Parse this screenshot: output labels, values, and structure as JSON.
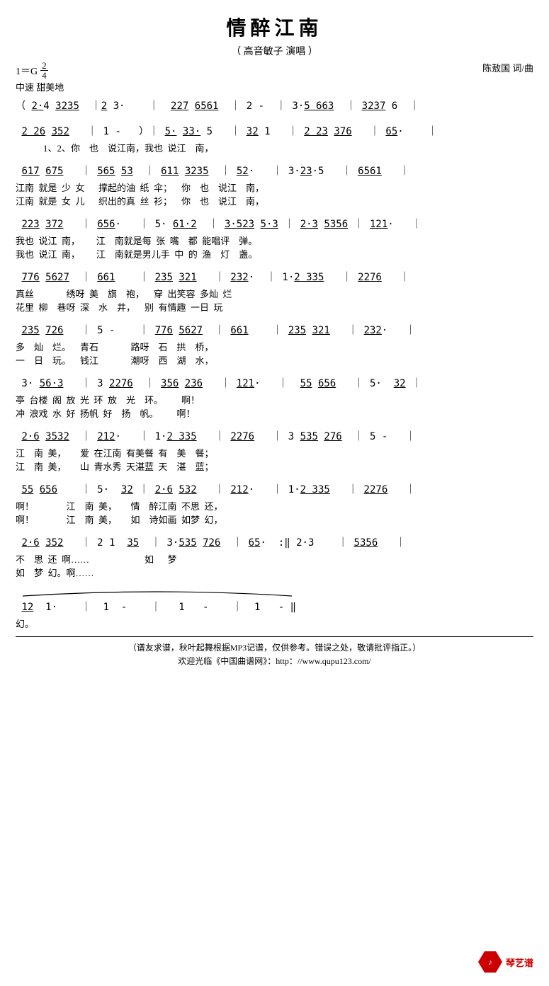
{
  "title": "情醉江南",
  "subtitle": "（ 高音敏子 演唱 ）",
  "composer": "陈敖国 词/曲",
  "key": "1＝G",
  "time_sig": {
    "num": "2",
    "den": "4"
  },
  "tempo": "中速 甜美地",
  "footer": {
    "line1": "（谱友求谱，秋叶起舞根据MP3记谱，仅供参考。错误之处，敬请批评指正。）",
    "line2": "欢迎光临《中国曲谱网》：http：//www.qupu123.com/"
  },
  "watermark": "琴艺谱",
  "staff_lines": [
    {
      "notation": "（ 2·4 3235  | 2 3·    |  227 6561  | 2 -   | 3·5 663   | 3237 6  |",
      "lyrics1": "",
      "lyrics2": ""
    },
    {
      "notation": " 2 26 352   | 1 -   )| 5· 33· 5   | 3̲2̲ 1   | 2 23 376   | 65·    |",
      "lyrics1": "           1、2、你    也    说江南，我也  说江    南，",
      "lyrics2": ""
    },
    {
      "notation": " 617 675   | 565 53  | 611 3235  | 52·   | 3·23·5   | 6561   |",
      "lyrics1": "江南  就是  少  女      撑起的油  纸  伞；    你    也    说江    南，",
      "lyrics2": "江南  就是  女  儿      织出的真  丝  衫；    你    也    说江    南，"
    },
    {
      "notation": " 223 372   | 656·   | 5· 61·2  | 3·523 5·3 | 2·3 5356 | 121·   |",
      "lyrics1": "我也  说江  南，       江    南就是每  张  嘴    都  能唱评    弹。",
      "lyrics2": "我也  说江  南，       江    南就是男儿手  中  的  渔    灯    盏。"
    },
    {
      "notation": " 776 5627  | 661    | 235 321   | 232·  | 1·2 335   | 2276   |",
      "lyrics1": "真丝              绣呀  美    旗    袍，    穿  出笑容  多灿  烂",
      "lyrics2": "花里  柳    巷呀  深    水    井，    别  有情趣  一日  玩"
    },
    {
      "notation": " 235 726   | 5 -    | 776 5627  | 661    | 235 321   | 232·   |",
      "lyrics1": "多    灿    烂。    青石              路呀    石    拱    桥，",
      "lyrics2": "一    日    玩。    钱江              潮呀    西    湖    水，"
    },
    {
      "notation": " 3· 56·3   | 3 2276  | 356 236   | 121·   |  55 656   | 5·  32 |",
      "lyrics1": "亭  台楼  阁  放  光  环  放    光    环。        啊！",
      "lyrics2": "冲  浪戏  水  好  扬帆  好    扬    帆。        啊！"
    },
    {
      "notation": " 2·6 3532  | 212·   | 1·2 335   | 2276   | 3 535 276  | 5 -   |",
      "lyrics1": "江    南  美，      爱  在江南  有美餐  有    美    餐；",
      "lyrics2": "江    南  美，      山  青水秀  天湛蓝  天    湛    蓝；"
    },
    {
      "notation": " 55 656    | 5·  32 | 2·6 532   | 212·   | 1·2 335   | 2276   |",
      "lyrics1": "啊！              江    南  美，      情    醉江南  不思  还，",
      "lyrics2": "啊！              江    南  美，      如    诗如画  如梦  幻，"
    },
    {
      "notation": " 2·6 352   | 2 1  35  | 3·535 726  | 65·  :‖ 2·3    | 5356   |",
      "lyrics1": "不    思  还  啊……                        如      梦",
      "lyrics2": "如    梦  幻。啊……"
    },
    {
      "notation": " 12  1·    |  1  -    |   1   -    |  1   -   ‖",
      "lyrics1": "幻。",
      "lyrics2": ""
    }
  ]
}
